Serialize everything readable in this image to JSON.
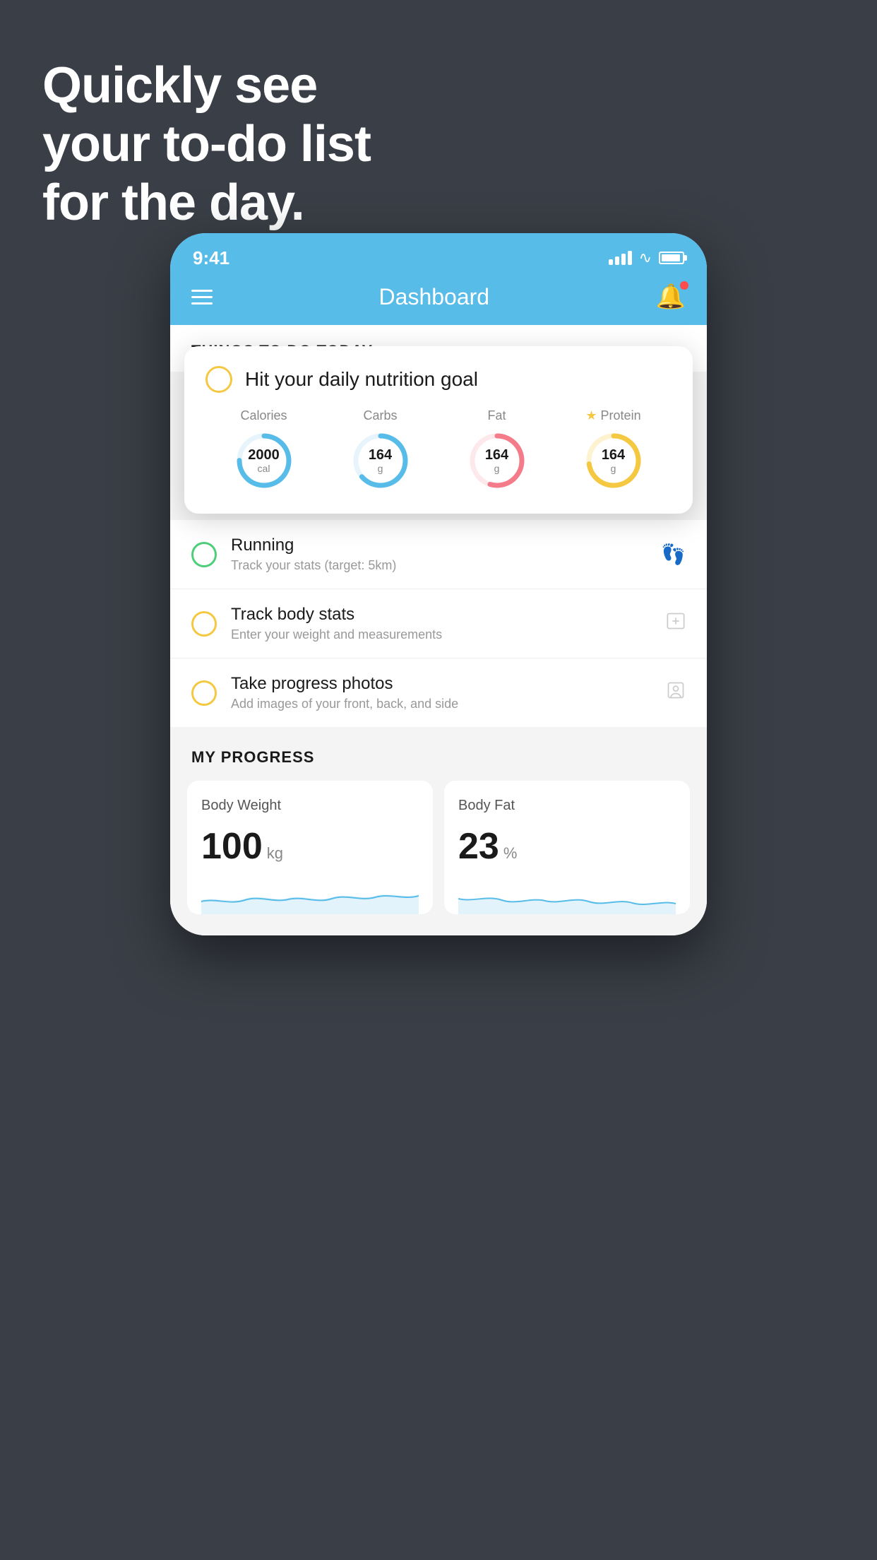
{
  "hero": {
    "line1": "Quickly see",
    "line2": "your to-do list",
    "line3": "for the day."
  },
  "statusBar": {
    "time": "9:41"
  },
  "header": {
    "title": "Dashboard"
  },
  "sectionTitle": "THINGS TO DO TODAY",
  "floatingCard": {
    "circleColor": "#f5c842",
    "title": "Hit your daily nutrition goal",
    "stats": [
      {
        "label": "Calories",
        "value": "2000",
        "unit": "cal",
        "color": "#58bce8",
        "dasharray": 220,
        "dashoffset": 55
      },
      {
        "label": "Carbs",
        "value": "164",
        "unit": "g",
        "color": "#58bce8",
        "dasharray": 220,
        "dashoffset": 80
      },
      {
        "label": "Fat",
        "value": "164",
        "unit": "g",
        "color": "#f47c8a",
        "dasharray": 220,
        "dashoffset": 100
      },
      {
        "label": "Protein",
        "value": "164",
        "unit": "g",
        "color": "#f5c842",
        "dasharray": 220,
        "dashoffset": 60,
        "star": true
      }
    ]
  },
  "todoItems": [
    {
      "type": "green",
      "title": "Running",
      "subtitle": "Track your stats (target: 5km)",
      "icon": "shoe"
    },
    {
      "type": "yellow",
      "title": "Track body stats",
      "subtitle": "Enter your weight and measurements",
      "icon": "scale"
    },
    {
      "type": "yellow",
      "title": "Take progress photos",
      "subtitle": "Add images of your front, back, and side",
      "icon": "portrait"
    }
  ],
  "progressSection": {
    "title": "MY PROGRESS",
    "cards": [
      {
        "title": "Body Weight",
        "value": "100",
        "unit": "kg"
      },
      {
        "title": "Body Fat",
        "value": "23",
        "unit": "%"
      }
    ]
  }
}
